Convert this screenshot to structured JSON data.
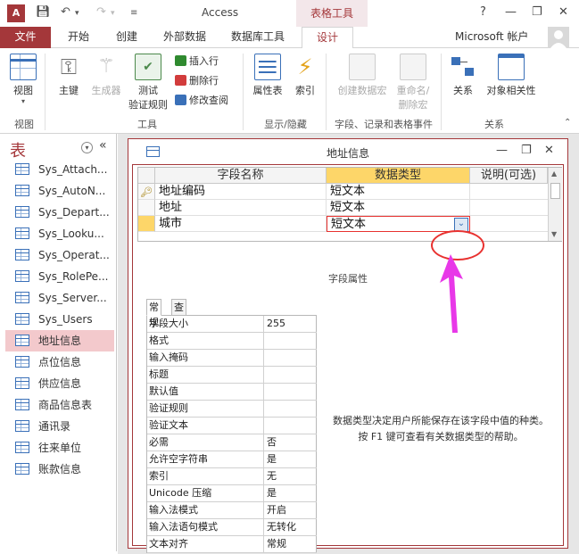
{
  "titlebar": {
    "app_title": "Access",
    "contextual_header": "表格工具",
    "help": "?",
    "minimize": "—",
    "restore": "❐",
    "close": "✕"
  },
  "tabs": {
    "file": "文件",
    "home": "开始",
    "create": "创建",
    "external": "外部数据",
    "dbtools": "数据库工具",
    "design": "设计",
    "account": "Microsoft 帐户"
  },
  "ribbon": {
    "view": "视图",
    "primary_key": "主键",
    "builder": "生成器",
    "test_rules_1": "测试",
    "test_rules_2": "验证规则",
    "insert_rows": "插入行",
    "delete_rows": "删除行",
    "modify_lookups": "修改查阅",
    "property_sheet": "属性表",
    "indexes": "索引",
    "create_macros": "创建数据宏",
    "rename_macro_1": "重命名/",
    "rename_macro_2": "删除宏",
    "relationships": "关系",
    "object_deps": "对象相关性",
    "groups": {
      "views": "视图",
      "tools": "工具",
      "show_hide": "显示/隐藏",
      "field_events": "字段、记录和表格事件",
      "relationships": "关系"
    }
  },
  "nav": {
    "title": "表",
    "collapse": "«",
    "items": [
      "Sys_Attach...",
      "Sys_AutoN...",
      "Sys_Depart...",
      "Sys_Looku...",
      "Sys_Operat...",
      "Sys_RolePe...",
      "Sys_Server...",
      "Sys_Users",
      "地址信息",
      "点位信息",
      "供应信息",
      "商品信息表",
      "通讯录",
      "往来单位",
      "账款信息"
    ],
    "selected_index": 8
  },
  "document": {
    "title": "地址信息",
    "grid_headers": {
      "field_name": "字段名称",
      "data_type": "数据类型",
      "description": "说明(可选)"
    },
    "rows": [
      {
        "name": "地址编码",
        "type": "短文本"
      },
      {
        "name": "地址",
        "type": "短文本"
      },
      {
        "name": "城市",
        "type": "短文本"
      }
    ],
    "field_properties_label": "字段属性",
    "prop_tabs": {
      "general": "常规",
      "lookup": "查阅"
    },
    "properties": [
      {
        "name": "字段大小",
        "value": "255"
      },
      {
        "name": "格式",
        "value": ""
      },
      {
        "name": "输入掩码",
        "value": ""
      },
      {
        "name": "标题",
        "value": ""
      },
      {
        "name": "默认值",
        "value": ""
      },
      {
        "name": "验证规则",
        "value": ""
      },
      {
        "name": "验证文本",
        "value": ""
      },
      {
        "name": "必需",
        "value": "否"
      },
      {
        "name": "允许空字符串",
        "value": "是"
      },
      {
        "name": "索引",
        "value": "无"
      },
      {
        "name": "Unicode 压缩",
        "value": "是"
      },
      {
        "name": "输入法模式",
        "value": "开启"
      },
      {
        "name": "输入法语句模式",
        "value": "无转化"
      },
      {
        "name": "文本对齐",
        "value": "常规"
      }
    ],
    "help_text": "数据类型决定用户所能保存在该字段中值的种类。按 F1 键可查看有关数据类型的帮助。"
  },
  "colors": {
    "accent": "#a4373a",
    "selected_nav": "#f3c9cc",
    "row_selector_active": "#fdd669",
    "annotation": "#e8312f",
    "arrow": "#e838e8"
  }
}
